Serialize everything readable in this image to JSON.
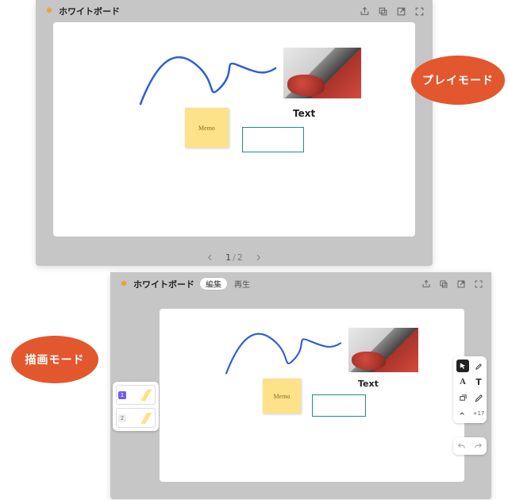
{
  "app": {
    "title": "ホワイトボード"
  },
  "playMode": {
    "badge": "プレイモード",
    "stickyText": "Memo",
    "textLabel": "Text",
    "pager": {
      "current": "1",
      "sep": "/",
      "total": "2"
    }
  },
  "drawMode": {
    "badge": "描画モード",
    "tabs": {
      "edit": "編集",
      "play": "再生"
    },
    "stickyText": "Memo",
    "textLabel": "Text",
    "slides": [
      {
        "num": "1"
      },
      {
        "num": "2"
      }
    ],
    "tools": {
      "more": "+17"
    }
  },
  "icons": {
    "share": "share-icon",
    "popout": "popout-icon",
    "open": "open-icon",
    "fullscreen": "fullscreen-icon",
    "prev": "chevron-left-icon",
    "next": "chevron-right-icon",
    "cursor": "cursor-icon",
    "marker": "marker-icon",
    "textA": "text-a-icon",
    "textT": "text-t-icon",
    "shape": "shape-icon",
    "pen": "pen-icon",
    "media": "expand-icon",
    "undo": "undo-icon",
    "redo": "redo-icon"
  }
}
